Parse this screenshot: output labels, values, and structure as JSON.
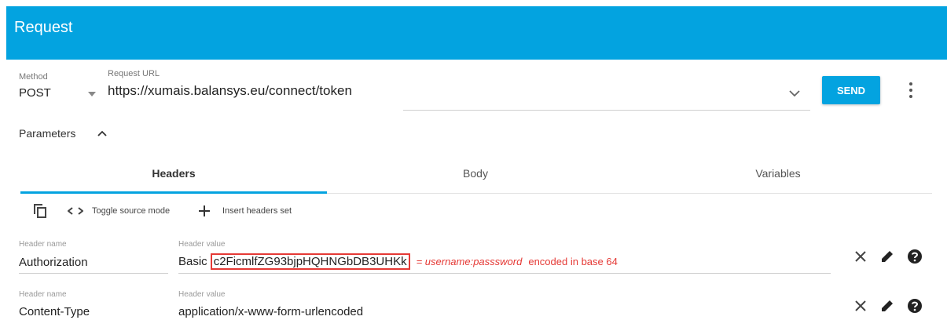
{
  "header": {
    "title": "Request"
  },
  "request": {
    "method_label": "Method",
    "method_value": "POST",
    "url_label": "Request URL",
    "url_value": "https://xumais.balansys.eu/connect/token",
    "send_label": "SEND"
  },
  "parameters": {
    "label": "Parameters"
  },
  "tabs": [
    {
      "label": "Headers",
      "selected": true
    },
    {
      "label": "Body",
      "selected": false
    },
    {
      "label": "Variables",
      "selected": false
    }
  ],
  "toolbar": {
    "toggle_label": "Toggle source mode",
    "insert_label": "Insert headers set"
  },
  "headers": [
    {
      "name_label": "Header name",
      "name": "Authorization",
      "value_label": "Header value",
      "value_prefix": "Basic",
      "value_token": "c2FicmlfZG93bjpHQHNGbDB3UHKk",
      "annotation_italic": "= username:passsword",
      "annotation_plain": "encoded in base 64"
    },
    {
      "name_label": "Header name",
      "name": "Content-Type",
      "value_label": "Header value",
      "value": "application/x-www-form-urlencoded"
    }
  ],
  "colors": {
    "accent": "#03a3e0",
    "annotation": "#e53935"
  },
  "icons": [
    "copy-icon",
    "code-icon",
    "plus-icon",
    "chevron-up-icon",
    "chevron-down-icon",
    "more-vert-icon",
    "close-icon",
    "edit-icon",
    "help-icon"
  ]
}
